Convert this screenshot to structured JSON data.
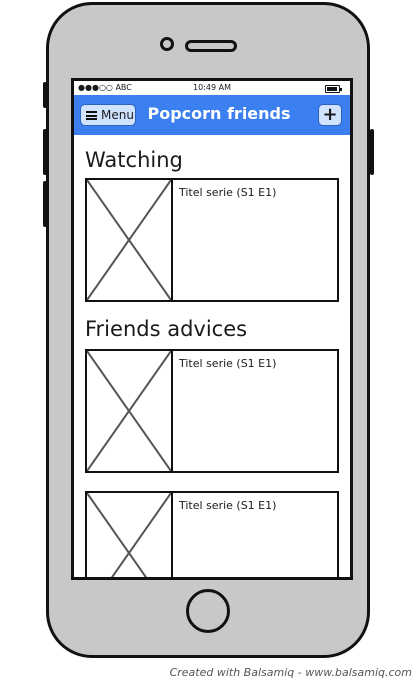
{
  "status_bar": {
    "carrier": "●●●○○ ABC",
    "time": "10:49 AM"
  },
  "navbar": {
    "menu_icon": "hamburger-menu-icon",
    "menu_label": "Menu",
    "title": "Popcorn friends",
    "add_label": "+",
    "accent_color": "#3b7ff0"
  },
  "sections": {
    "watching": {
      "title": "Watching",
      "items": [
        {
          "title": "Titel serie (S1 E1)"
        }
      ]
    },
    "friends_advices": {
      "title": "Friends advices",
      "items": [
        {
          "title": "Titel serie (S1 E1)"
        },
        {
          "title": "Titel serie (S1 E1)"
        }
      ]
    }
  },
  "footer": {
    "credit": "Created with Balsamiq - www.balsamiq.com"
  }
}
